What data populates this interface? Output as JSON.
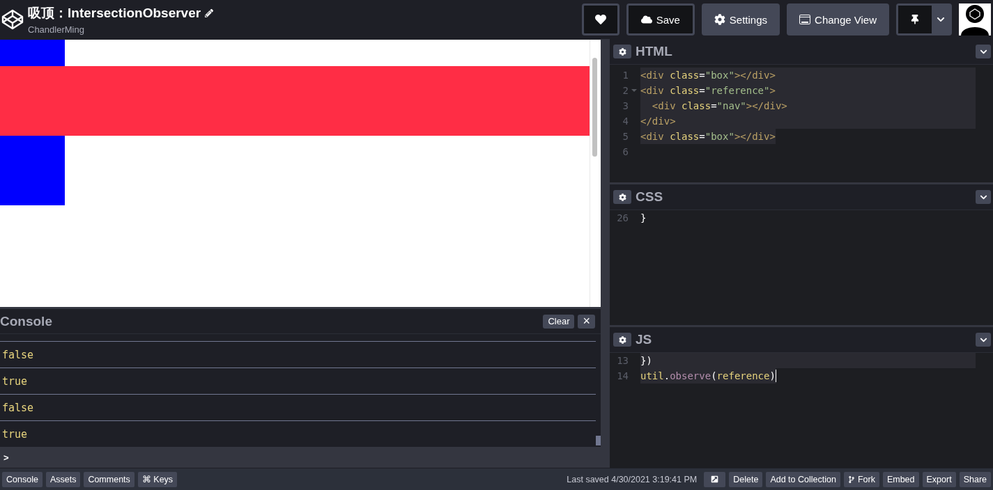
{
  "header": {
    "title": "吸顶：IntersectionObserver",
    "author": "ChandlerMing",
    "save": "Save",
    "settings": "Settings",
    "change_view": "Change View"
  },
  "console": {
    "title": "Console",
    "clear": "Clear",
    "close": "×",
    "rows": [
      "false",
      "true",
      "false",
      "true"
    ],
    "prompt": ">"
  },
  "editors": [
    {
      "title": "HTML",
      "lines": [
        {
          "num": "1",
          "kind": "full",
          "tokens": [
            {
              "t": "<div ",
              "kind": "tag"
            },
            {
              "t": "class",
              "kind": "attr"
            },
            {
              "t": "=",
              "kind": "plain"
            },
            {
              "t": "\"box\"",
              "kind": "str"
            },
            {
              "t": "></div>",
              "kind": "tag"
            }
          ]
        },
        {
          "num": "2",
          "kind": "full",
          "fold": true,
          "tokens": [
            {
              "t": "<div ",
              "kind": "tag"
            },
            {
              "t": "class",
              "kind": "attr"
            },
            {
              "t": "=",
              "kind": "plain"
            },
            {
              "t": "\"reference\"",
              "kind": "str"
            },
            {
              "t": ">",
              "kind": "tag"
            }
          ]
        },
        {
          "num": "3",
          "kind": "full",
          "tokens": [
            {
              "t": "  <div ",
              "kind": "tag"
            },
            {
              "t": "class",
              "kind": "attr"
            },
            {
              "t": "=",
              "kind": "plain"
            },
            {
              "t": "\"nav\"",
              "kind": "str"
            },
            {
              "t": "></div>",
              "kind": "tag"
            }
          ]
        },
        {
          "num": "4",
          "kind": "full",
          "tokens": [
            {
              "t": "</div>",
              "kind": "tag"
            }
          ]
        },
        {
          "num": "5",
          "kind": "partial",
          "tokens": [
            {
              "t": "<div ",
              "kind": "tag"
            },
            {
              "t": "class",
              "kind": "attr"
            },
            {
              "t": "=",
              "kind": "plain"
            },
            {
              "t": "\"box\"",
              "kind": "str"
            },
            {
              "t": "></div>",
              "kind": "tag"
            }
          ]
        },
        {
          "num": "6"
        }
      ]
    },
    {
      "title": "CSS",
      "lines": [
        {
          "num": "26",
          "kind": "plain",
          "tokens": [
            {
              "t": "}",
              "kind": "plain"
            }
          ]
        }
      ]
    },
    {
      "title": "JS",
      "lines": [
        {
          "num": "13",
          "kind": "full",
          "tokens": [
            {
              "t": "})",
              "kind": "plain"
            }
          ]
        },
        {
          "num": "14",
          "kind": "partial",
          "cursor": true,
          "tokens": [
            {
              "t": "util",
              "kind": "attr"
            },
            {
              "t": ".",
              "kind": "plain"
            },
            {
              "t": "observe",
              "kind": "fn"
            },
            {
              "t": "(",
              "kind": "plain"
            },
            {
              "t": "reference",
              "kind": "attr"
            },
            {
              "t": ")",
              "kind": "plain"
            }
          ]
        }
      ]
    }
  ],
  "footer": {
    "left": [
      "Console",
      "Assets",
      "Comments",
      "⌘ Keys"
    ],
    "saved": "Last saved 4/30/2021 3:19:41 PM",
    "right": [
      {
        "label": "Delete"
      },
      {
        "label": "Add to Collection"
      },
      {
        "label": "Fork",
        "kind": "fork"
      },
      {
        "label": "Embed"
      },
      {
        "label": "Export"
      },
      {
        "label": "Share"
      }
    ]
  }
}
